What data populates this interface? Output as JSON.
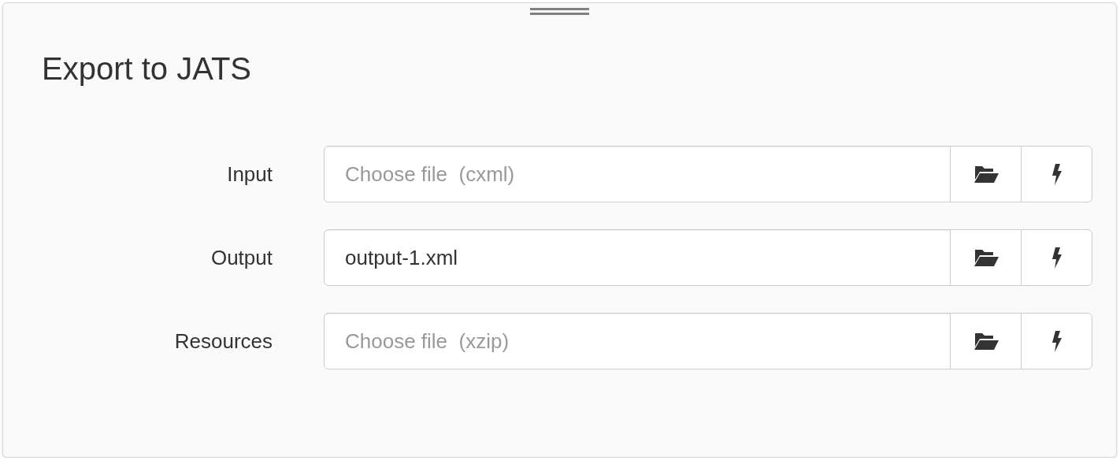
{
  "dialog": {
    "title": "Export to JATS"
  },
  "fields": [
    {
      "label": "Input",
      "placeholder": "Choose file  (cxml)"
    },
    {
      "label": "Output",
      "value": "output-1.xml"
    },
    {
      "label": "Resources",
      "placeholder": "Choose file  (xzip)"
    }
  ]
}
